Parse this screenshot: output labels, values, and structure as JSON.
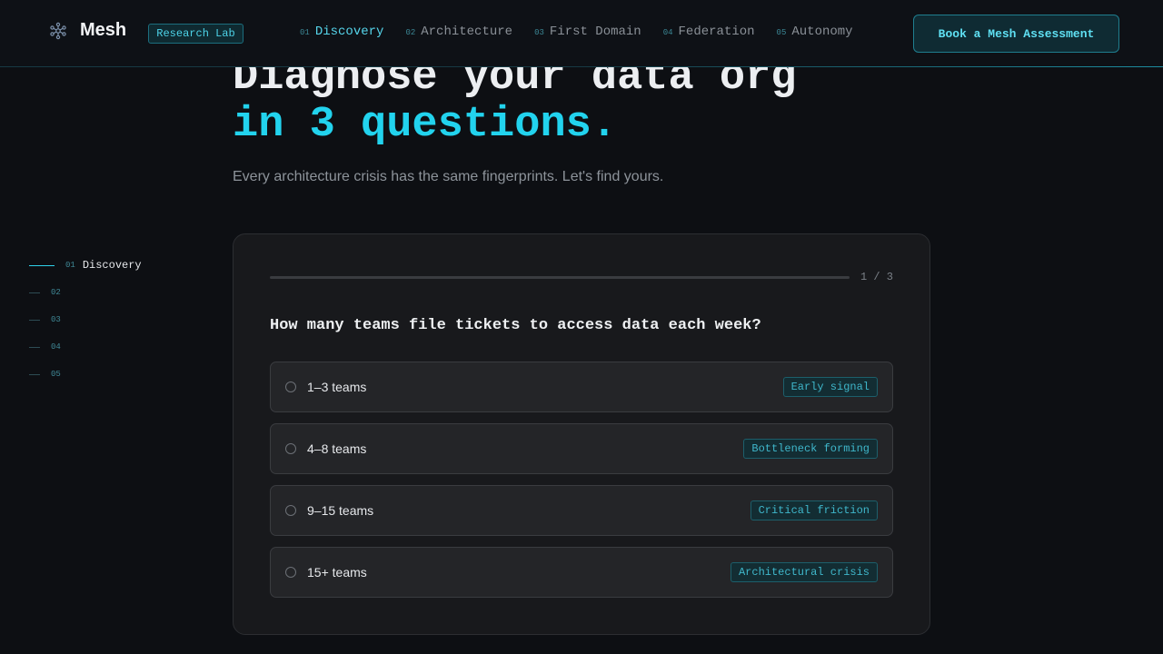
{
  "header": {
    "brand": "Mesh",
    "badge": "Research Lab",
    "nav": [
      {
        "num": "01",
        "label": "Discovery",
        "active": true
      },
      {
        "num": "02",
        "label": "Architecture"
      },
      {
        "num": "03",
        "label": "First Domain"
      },
      {
        "num": "04",
        "label": "Federation"
      },
      {
        "num": "05",
        "label": "Autonomy"
      }
    ],
    "cta": "Book a Mesh Assessment"
  },
  "hero": {
    "line1": "Diagnose your data org",
    "line2": "in 3 questions.",
    "subtitle": "Every architecture crisis has the same fingerprints. Let's find yours."
  },
  "rail": [
    {
      "num": "01",
      "label": "Discovery",
      "active": true
    },
    {
      "num": "02",
      "label": ""
    },
    {
      "num": "03",
      "label": ""
    },
    {
      "num": "04",
      "label": ""
    },
    {
      "num": "05",
      "label": ""
    }
  ],
  "quiz": {
    "progress_text": "1 / 3",
    "progress_fraction": 0.0,
    "question": "How many teams file tickets to access data each week?",
    "options": [
      {
        "label": "1–3 teams",
        "tag": "Early signal"
      },
      {
        "label": "4–8 teams",
        "tag": "Bottleneck forming"
      },
      {
        "label": "9–15 teams",
        "tag": "Critical friction"
      },
      {
        "label": "15+ teams",
        "tag": "Architectural crisis"
      }
    ]
  },
  "colors": {
    "accent": "#22d3ee",
    "background": "#0d0f13",
    "card": "#18191c"
  },
  "icons": {
    "brand": "mesh-network-icon"
  }
}
